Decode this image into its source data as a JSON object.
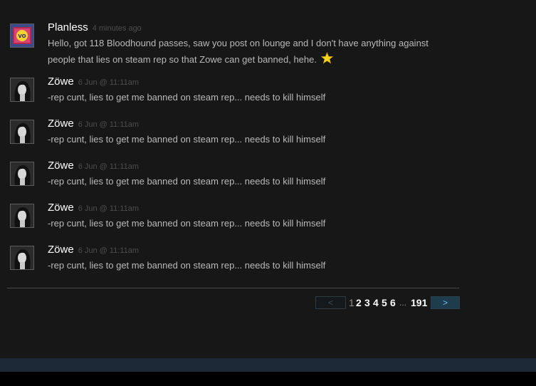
{
  "comments": [
    {
      "author": "Planless",
      "timestamp": "4 minutes ago",
      "text_line1": "Hello, got 118 Bloodhound passes, saw you post on lounge and I don't have anything against",
      "text_line2": "people that lies on steam rep so that Zowe can get banned, hehe.",
      "emoticon": "star-emoticon",
      "avatar_text": "VAPORNS!"
    },
    {
      "author": "Zöwe",
      "timestamp": "6 Jun @ 11:11am",
      "text": "-rep cunt, lies to get me banned on steam rep... needs to kill himself"
    },
    {
      "author": "Zöwe",
      "timestamp": "6 Jun @ 11:11am",
      "text": "-rep cunt, lies to get me banned on steam rep... needs to kill himself"
    },
    {
      "author": "Zöwe",
      "timestamp": "6 Jun @ 11:11am",
      "text": "-rep cunt, lies to get me banned on steam rep... needs to kill himself"
    },
    {
      "author": "Zöwe",
      "timestamp": "6 Jun @ 11:11am",
      "text": "-rep cunt, lies to get me banned on steam rep... needs to kill himself"
    },
    {
      "author": "Zöwe",
      "timestamp": "6 Jun @ 11:11am",
      "text": "-rep cunt, lies to get me banned on steam rep... needs to kill himself"
    }
  ],
  "pagination": {
    "prev_label": "<",
    "pages": [
      "1",
      "2",
      "3",
      "4",
      "5",
      "6"
    ],
    "current_page": "1",
    "ellipsis": "...",
    "last_page": "191",
    "next_label": ">"
  },
  "colors": {
    "background": "#171717",
    "author": "#ffffff",
    "comment_text": "#b9b9b9",
    "timestamp": "#4d4d4d",
    "next_button": "#1f3c4d",
    "footer_bar": "#1d2936"
  }
}
